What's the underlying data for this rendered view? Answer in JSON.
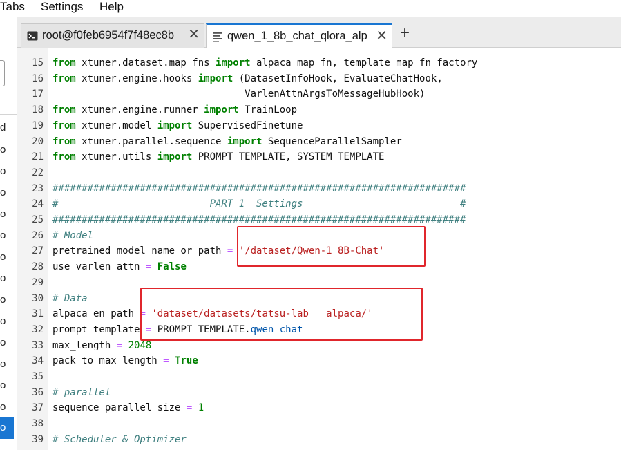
{
  "menu": {
    "items": [
      "Tabs",
      "Settings",
      "Help"
    ]
  },
  "left_panel": {
    "labels": [
      "d",
      "o",
      "o",
      "o",
      "o",
      "o",
      "o",
      "o",
      "o",
      "o",
      "o",
      "o",
      "o",
      "o",
      "o"
    ],
    "selected_label": "o"
  },
  "tabs": [
    {
      "label": "root@f0feb6954f7f48ec8b",
      "icon": "terminal-icon",
      "close": "✕"
    },
    {
      "label": "qwen_1_8b_chat_qlora_alp",
      "icon": "text-file-icon",
      "close": "✕"
    }
  ],
  "add_tab": "+",
  "colors": {
    "accent": "#1976d2",
    "highlight_box": "#e0262c",
    "keyword": "#008000",
    "string": "#ba2121",
    "comment": "#408080"
  },
  "editor": {
    "first_partial_line": "                                  _    ",
    "lines": [
      {
        "n": "15",
        "segs": [
          [
            "kw",
            "from"
          ],
          [
            "t",
            " xtuner.dataset.map_fns "
          ],
          [
            "kw",
            "import"
          ],
          [
            "t",
            " alpaca_map_fn, template_map_fn_factory"
          ]
        ]
      },
      {
        "n": "16",
        "segs": [
          [
            "kw",
            "from"
          ],
          [
            "t",
            " xtuner.engine.hooks "
          ],
          [
            "kw",
            "import"
          ],
          [
            "t",
            " (DatasetInfoHook, EvaluateChatHook,"
          ]
        ]
      },
      {
        "n": "17",
        "segs": [
          [
            "t",
            "                                 VarlenAttnArgsToMessageHubHook)"
          ]
        ]
      },
      {
        "n": "18",
        "segs": [
          [
            "kw",
            "from"
          ],
          [
            "t",
            " xtuner.engine.runner "
          ],
          [
            "kw",
            "import"
          ],
          [
            "t",
            " TrainLoop"
          ]
        ]
      },
      {
        "n": "19",
        "segs": [
          [
            "kw",
            "from"
          ],
          [
            "t",
            " xtuner.model "
          ],
          [
            "kw",
            "import"
          ],
          [
            "t",
            " SupervisedFinetune"
          ]
        ]
      },
      {
        "n": "20",
        "segs": [
          [
            "kw",
            "from"
          ],
          [
            "t",
            " xtuner.parallel.sequence "
          ],
          [
            "kw",
            "import"
          ],
          [
            "t",
            " SequenceParallelSampler"
          ]
        ]
      },
      {
        "n": "21",
        "segs": [
          [
            "kw",
            "from"
          ],
          [
            "t",
            " xtuner.utils "
          ],
          [
            "kw",
            "import"
          ],
          [
            "t",
            " PROMPT_TEMPLATE, SYSTEM_TEMPLATE"
          ]
        ]
      },
      {
        "n": "22",
        "segs": []
      },
      {
        "n": "23",
        "segs": [
          [
            "cm",
            "#######################################################################"
          ]
        ]
      },
      {
        "n": "24",
        "segs": [
          [
            "cm",
            "#                          PART 1  Settings                           #"
          ]
        ]
      },
      {
        "n": "25",
        "segs": [
          [
            "cm",
            "#######################################################################"
          ]
        ]
      },
      {
        "n": "26",
        "segs": [
          [
            "cm",
            "# Model"
          ]
        ]
      },
      {
        "n": "27",
        "segs": [
          [
            "t",
            "pretrained_model_name_or_path "
          ],
          [
            "op",
            "="
          ],
          [
            "t",
            " "
          ],
          [
            "str",
            "'/dataset/Qwen-1_8B-Chat'"
          ]
        ]
      },
      {
        "n": "28",
        "segs": [
          [
            "t",
            "use_varlen_attn "
          ],
          [
            "op",
            "="
          ],
          [
            "t",
            " "
          ],
          [
            "kw",
            "False"
          ]
        ]
      },
      {
        "n": "29",
        "segs": []
      },
      {
        "n": "30",
        "segs": [
          [
            "cm",
            "# Data"
          ]
        ]
      },
      {
        "n": "31",
        "segs": [
          [
            "t",
            "alpaca_en_path "
          ],
          [
            "op",
            "="
          ],
          [
            "t",
            " "
          ],
          [
            "str",
            "'dataset/datasets/tatsu-lab___alpaca/'"
          ]
        ]
      },
      {
        "n": "32",
        "segs": [
          [
            "t",
            "prompt_template "
          ],
          [
            "op",
            "="
          ],
          [
            "t",
            " PROMPT_TEMPLATE."
          ],
          [
            "attr",
            "qwen_chat"
          ]
        ]
      },
      {
        "n": "33",
        "segs": [
          [
            "t",
            "max_length "
          ],
          [
            "op",
            "="
          ],
          [
            "t",
            " "
          ],
          [
            "num",
            "2048"
          ]
        ]
      },
      {
        "n": "34",
        "segs": [
          [
            "t",
            "pack_to_max_length "
          ],
          [
            "op",
            "="
          ],
          [
            "t",
            " "
          ],
          [
            "kw",
            "True"
          ]
        ]
      },
      {
        "n": "35",
        "segs": []
      },
      {
        "n": "36",
        "segs": [
          [
            "cm",
            "# parallel"
          ]
        ]
      },
      {
        "n": "37",
        "segs": [
          [
            "t",
            "sequence_parallel_size "
          ],
          [
            "op",
            "="
          ],
          [
            "t",
            " "
          ],
          [
            "num",
            "1"
          ]
        ]
      },
      {
        "n": "38",
        "segs": []
      },
      {
        "n": "39",
        "segs": [
          [
            "cm",
            "# Scheduler & Optimizer"
          ]
        ]
      }
    ]
  }
}
